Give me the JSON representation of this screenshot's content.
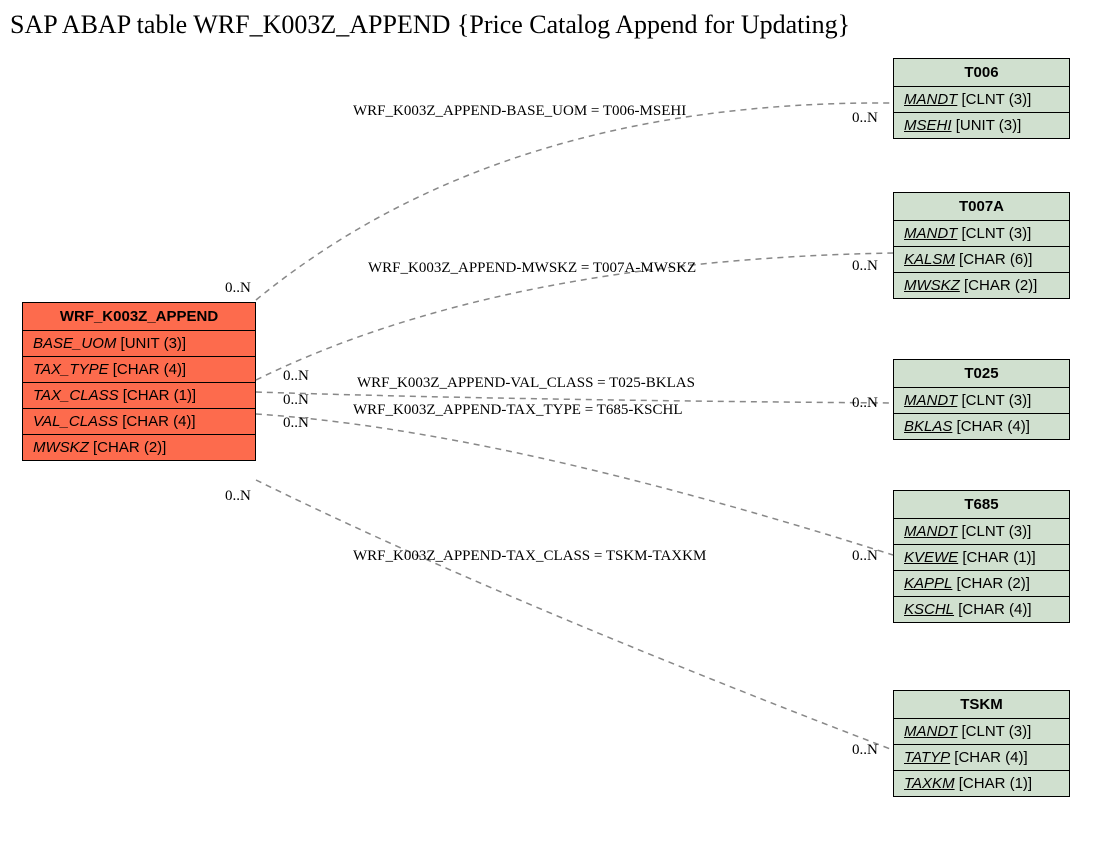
{
  "title": "SAP ABAP table WRF_K003Z_APPEND {Price Catalog Append for Updating}",
  "source": {
    "name": "WRF_K003Z_APPEND",
    "fields": [
      {
        "name": "BASE_UOM",
        "type": "[UNIT (3)]"
      },
      {
        "name": "TAX_TYPE",
        "type": "[CHAR (4)]"
      },
      {
        "name": "TAX_CLASS",
        "type": "[CHAR (1)]"
      },
      {
        "name": "VAL_CLASS",
        "type": "[CHAR (4)]"
      },
      {
        "name": "MWSKZ",
        "type": "[CHAR (2)]"
      }
    ]
  },
  "targets": [
    {
      "name": "T006",
      "fields": [
        {
          "name": "MANDT",
          "type": "[CLNT (3)]",
          "key": true
        },
        {
          "name": "MSEHI",
          "type": "[UNIT (3)]",
          "key": true
        }
      ]
    },
    {
      "name": "T007A",
      "fields": [
        {
          "name": "MANDT",
          "type": "[CLNT (3)]",
          "key": true
        },
        {
          "name": "KALSM",
          "type": "[CHAR (6)]",
          "key": true
        },
        {
          "name": "MWSKZ",
          "type": "[CHAR (2)]",
          "key": true
        }
      ]
    },
    {
      "name": "T025",
      "fields": [
        {
          "name": "MANDT",
          "type": "[CLNT (3)]",
          "key": true
        },
        {
          "name": "BKLAS",
          "type": "[CHAR (4)]",
          "key": true
        }
      ]
    },
    {
      "name": "T685",
      "fields": [
        {
          "name": "MANDT",
          "type": "[CLNT (3)]",
          "key": true
        },
        {
          "name": "KVEWE",
          "type": "[CHAR (1)]",
          "key": true
        },
        {
          "name": "KAPPL",
          "type": "[CHAR (2)]",
          "key": true
        },
        {
          "name": "KSCHL",
          "type": "[CHAR (4)]",
          "key": true
        }
      ]
    },
    {
      "name": "TSKM",
      "fields": [
        {
          "name": "MANDT",
          "type": "[CLNT (3)]",
          "key": true
        },
        {
          "name": "TATYP",
          "type": "[CHAR (4)]",
          "key": true
        },
        {
          "name": "TAXKM",
          "type": "[CHAR (1)]",
          "key": true
        }
      ]
    }
  ],
  "relations": [
    {
      "label": "WRF_K003Z_APPEND-BASE_UOM = T006-MSEHI"
    },
    {
      "label": "WRF_K003Z_APPEND-MWSKZ = T007A-MWSKZ"
    },
    {
      "label": "WRF_K003Z_APPEND-VAL_CLASS = T025-BKLAS"
    },
    {
      "label": "WRF_K003Z_APPEND-TAX_TYPE = T685-KSCHL"
    },
    {
      "label": "WRF_K003Z_APPEND-TAX_CLASS = TSKM-TAXKM"
    }
  ],
  "cardinality": "0..N"
}
